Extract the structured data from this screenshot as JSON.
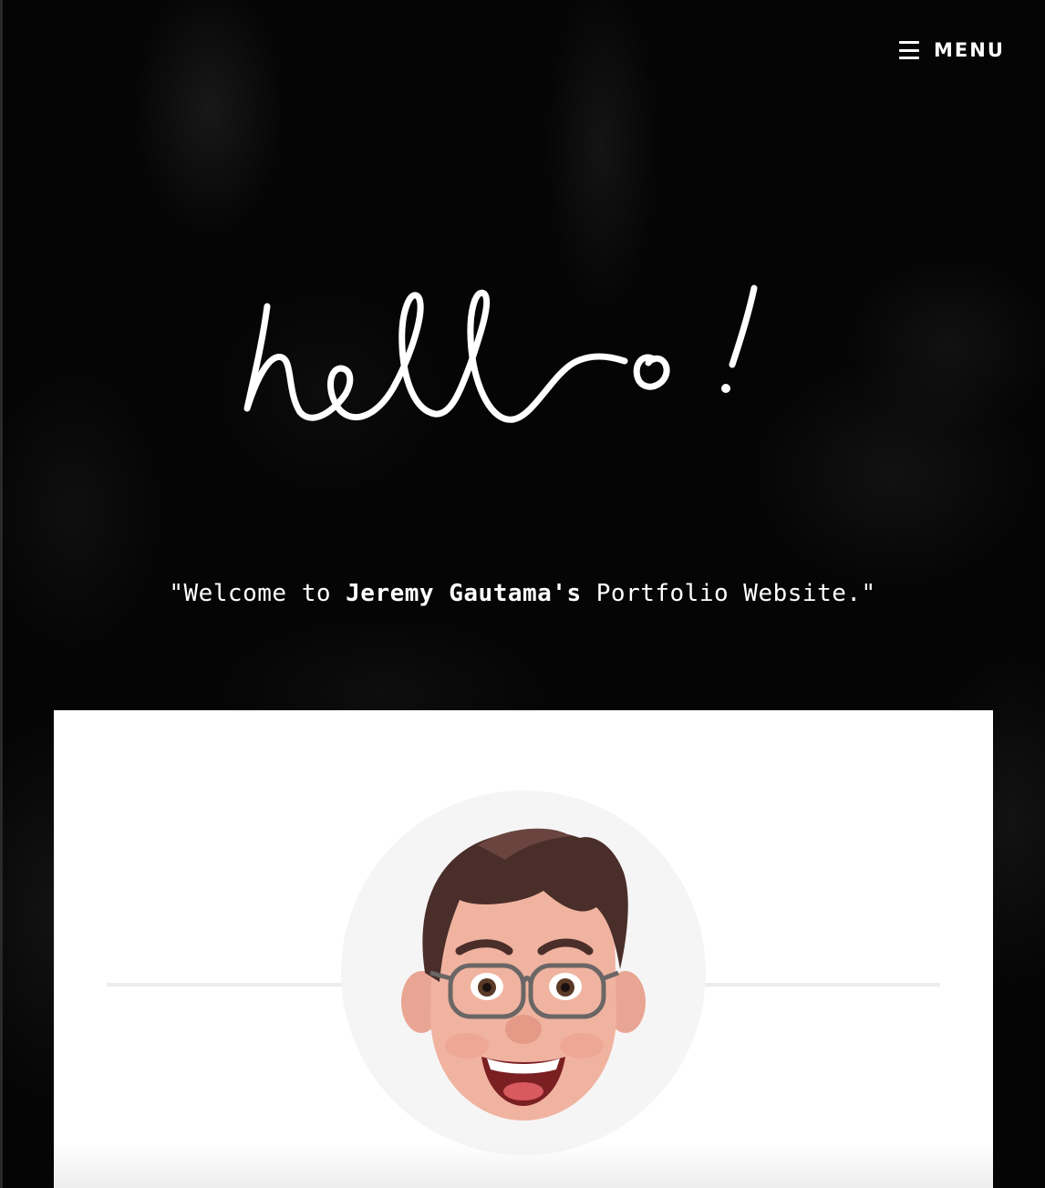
{
  "nav": {
    "menu_label": "MENU",
    "menu_icon": "hamburger-icon"
  },
  "hero": {
    "script_text": "hello!",
    "welcome_prefix": "\"Welcome to ",
    "welcome_name": "Jeremy Gautama's",
    "welcome_suffix": " Portfolio Website.\""
  },
  "profile": {
    "avatar": "memoji-avatar"
  },
  "colors": {
    "background": "#000000",
    "text": "#ffffff",
    "card": "#ffffff",
    "divider": "#ececec",
    "avatar_bg": "#f6f5f5"
  }
}
